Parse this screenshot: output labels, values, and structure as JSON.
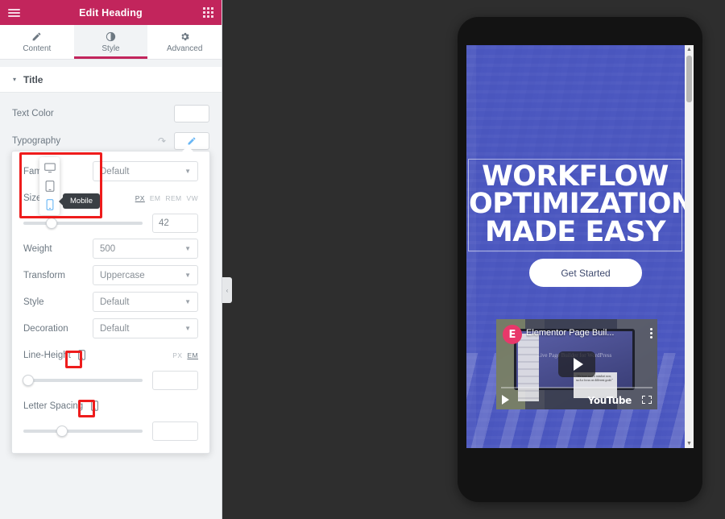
{
  "panel": {
    "header": {
      "title": "Edit Heading",
      "menu_icon": "hamburger-icon",
      "apps_icon": "grid-icon"
    },
    "tabs": [
      {
        "label": "Content",
        "icon": "pencil-icon",
        "active": false
      },
      {
        "label": "Style",
        "icon": "contrast-icon",
        "active": true
      },
      {
        "label": "Advanced",
        "icon": "gear-icon",
        "active": false
      }
    ],
    "section": {
      "title": "Title",
      "caret": "▾"
    },
    "controls": {
      "text_color_label": "Text Color",
      "text_color_value": "#ffffff",
      "typography_label": "Typography",
      "reset_icon": "reset-icon",
      "edit_icon": "pencil-edit-icon"
    },
    "typography": {
      "family_label": "Family",
      "family_value": "Default",
      "size_label": "Size",
      "size_units": [
        "PX",
        "EM",
        "REM",
        "VW"
      ],
      "size_unit_active": "PX",
      "size_value": "42",
      "weight_label": "Weight",
      "weight_value": "500",
      "transform_label": "Transform",
      "transform_value": "Uppercase",
      "style_label": "Style",
      "style_value": "Default",
      "decoration_label": "Decoration",
      "decoration_value": "Default",
      "line_height_label": "Line-Height",
      "line_height_units": [
        "PX",
        "EM"
      ],
      "line_height_unit_active": "EM",
      "line_height_value": "",
      "letter_spacing_label": "Letter Spacing",
      "letter_spacing_value": ""
    },
    "device_switcher": {
      "devices": [
        "desktop-icon",
        "tablet-icon",
        "mobile-icon"
      ],
      "active": "mobile-icon",
      "tooltip": "Mobile"
    },
    "collapse_icon": "‹"
  },
  "preview": {
    "heading_lines": [
      "WORKFLOW",
      "OPTIMIZATION",
      "MADE EASY"
    ],
    "cta_label": "Get Started",
    "video": {
      "title": "Elementor Page Buil...",
      "brand": "YouTube",
      "avatar_letter": "E",
      "overlay_text": "Live Page Builder for WordPress",
      "quote": "“We have such a mindset now, such a focus on different goals”"
    },
    "scrollbar": {
      "up": "▲",
      "down": "▼"
    }
  },
  "colors": {
    "brand_pink": "#c2225c",
    "highlight_red": "#ee1c1c",
    "accent_blue": "#6ab7f5",
    "preview_blue": "#4652be"
  }
}
